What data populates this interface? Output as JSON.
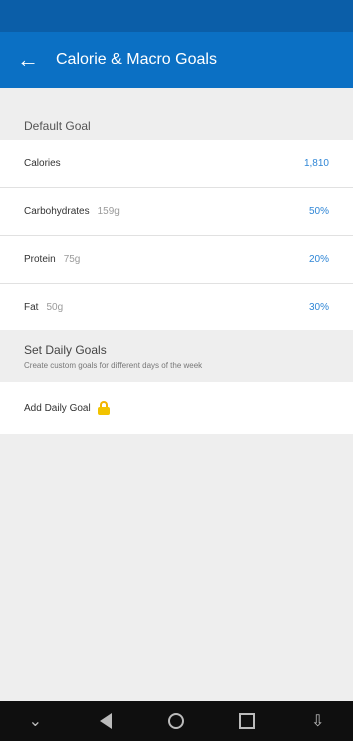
{
  "statusbar": {
    "left": "",
    "right": ""
  },
  "appbar": {
    "back_icon": "arrow-left-icon",
    "title": "Calorie & Macro Goals"
  },
  "default_goal": {
    "header": "Default Goal",
    "rows": [
      {
        "label": "Calories",
        "sub": "",
        "value": "1,810"
      },
      {
        "label": "Carbohydrates",
        "sub": "159g",
        "value": "50%"
      },
      {
        "label": "Protein",
        "sub": "75g",
        "value": "20%"
      },
      {
        "label": "Fat",
        "sub": "50g",
        "value": "30%"
      }
    ]
  },
  "daily_goals": {
    "title": "Set Daily Goals",
    "description": "Create custom goals for different days of the week",
    "add_label": "Add Daily Goal",
    "lock_icon": "lock-icon"
  },
  "navbar": {
    "items": [
      "chevron-down-icon",
      "back-triangle-icon",
      "home-circle-icon",
      "recent-square-icon",
      "notifications-icon"
    ]
  },
  "colors": {
    "statusbar": "#0b5ea8",
    "appbar": "#0b70c4",
    "value": "#2f86d6",
    "background": "#eeeeee"
  }
}
